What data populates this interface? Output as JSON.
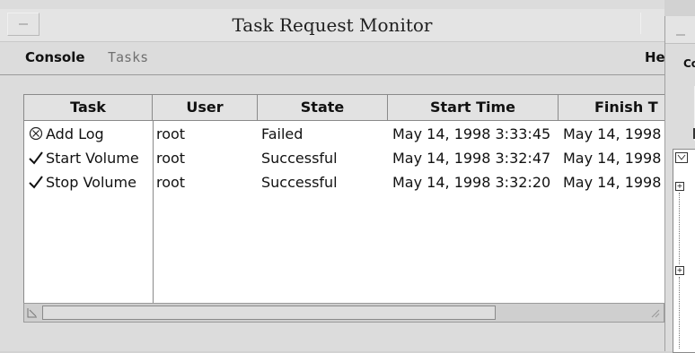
{
  "window": {
    "title": "Task Request Monitor"
  },
  "menu": {
    "console": "Console",
    "tasks": "Tasks",
    "help": "He"
  },
  "table": {
    "columns": [
      "Task",
      "User",
      "State",
      "Start Time",
      "Finish T"
    ],
    "rows": [
      {
        "icon": "failed-icon",
        "task": "Add Log",
        "user": "root",
        "state": "Failed",
        "start": "May 14, 1998 3:33:45",
        "finish": "May 14, 1998"
      },
      {
        "icon": "check-icon",
        "task": "Start Volume",
        "user": "root",
        "state": "Successful",
        "start": "May 14, 1998 3:32:47",
        "finish": "May 14, 1998"
      },
      {
        "icon": "check-icon",
        "task": "Stop Volume",
        "user": "root",
        "state": "Successful",
        "start": "May 14, 1998 3:32:20",
        "finish": "May 14, 1998"
      }
    ]
  },
  "background_window": {
    "label": "Co"
  }
}
